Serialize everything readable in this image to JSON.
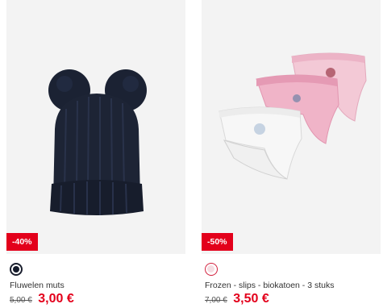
{
  "products": [
    {
      "badge": "-40%",
      "name": "Fluwelen muts",
      "old_price": "5,00 €",
      "new_price": "3,00 €",
      "swatch_color": "#141a2a"
    },
    {
      "badge": "-50%",
      "name": "Frozen - slips - biokatoen - 3 stuks",
      "old_price": "7,00 €",
      "new_price": "3,50 €",
      "swatch_color": "#f5dde2"
    }
  ],
  "accent_color": "#e3001b"
}
